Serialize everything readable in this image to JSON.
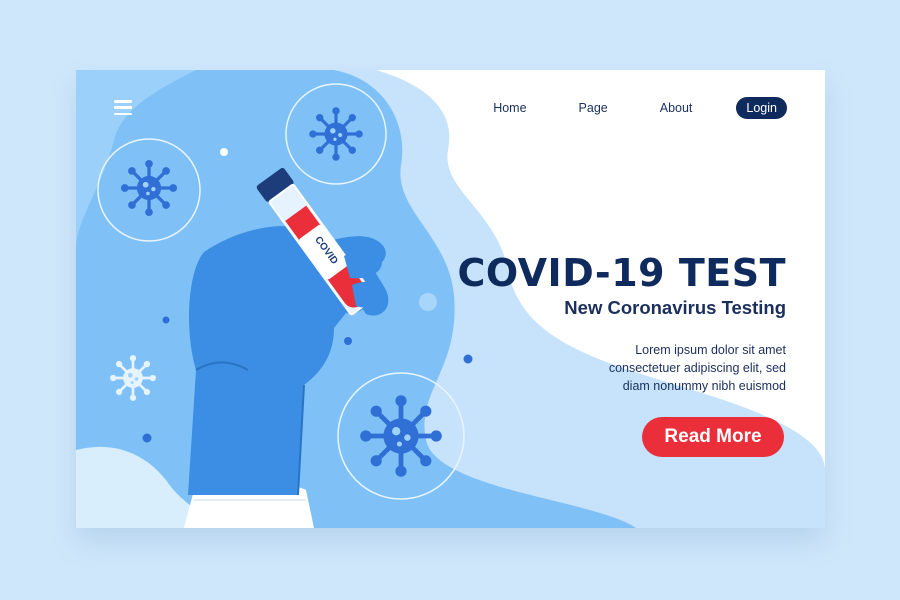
{
  "nav": {
    "menu_icon": "hamburger-menu-icon",
    "items": [
      {
        "label": "Home"
      },
      {
        "label": "Page"
      },
      {
        "label": "About"
      }
    ],
    "login_label": "Login"
  },
  "hero": {
    "title": "COVID-19 TEST",
    "subtitle": "New Coronavirus Testing",
    "body_lines": [
      "Lorem ipsum dolor sit amet",
      "consectetuer adipiscing elit, sed",
      "diam nonummy nibh euismod"
    ],
    "cta_label": "Read More"
  },
  "illustration": {
    "tube_label": "COVID",
    "icons": [
      "virus-icon",
      "gloved-hand-icon",
      "test-tube-icon"
    ]
  },
  "colors": {
    "page_background": "#cfe7fb",
    "navy": "#0f2a5c",
    "accent_red": "#ea2f3a",
    "glove_blue": "#3b8ee3",
    "blob_blue": "#7fc1f6"
  }
}
